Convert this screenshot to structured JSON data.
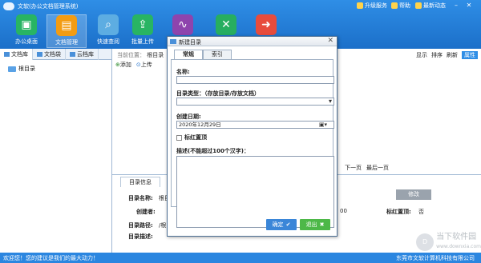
{
  "window": {
    "title": "文软(办公文档管理系统)",
    "top_links": [
      "升级服务",
      "帮助",
      "最新动态"
    ]
  },
  "toolbar": [
    {
      "label": "办公桌面",
      "icon": "desk-icon",
      "color": "#28b463"
    },
    {
      "label": "文档管理",
      "icon": "document-icon",
      "color": "#f39c12",
      "active": true
    },
    {
      "label": "快速查阅",
      "icon": "search-icon",
      "color": "#5dade2"
    },
    {
      "label": "批量上传",
      "icon": "upload-icon",
      "color": "#28b463"
    },
    {
      "label": "",
      "icon": "chart-icon",
      "color": "#8e44ad"
    },
    {
      "label": "",
      "icon": "tools-icon",
      "color": "#27ae60"
    },
    {
      "label": "",
      "icon": "exit-icon",
      "color": "#e74c3c"
    }
  ],
  "left": {
    "tabs": [
      "文档库",
      "文档袋",
      "云档库"
    ],
    "tree_root": "根目录"
  },
  "main": {
    "breadcrumb_label": "当前位置：",
    "breadcrumb_value": "根目录",
    "actions": [
      "添加",
      "上传"
    ],
    "right_actions": [
      "显示",
      "排序",
      "刷新",
      "属性"
    ],
    "pager": [
      "下一页",
      "最后一页"
    ],
    "info_tab": "目录信息",
    "info_labels": [
      "目录名称:",
      "创建者:",
      "目录路径:",
      "目录描述:"
    ],
    "info_values": [
      "根目",
      "",
      "/根目",
      ""
    ],
    "edit_button": "修改",
    "flag_label": "标红置顶:",
    "flag_value": "否",
    "partial_value": "00"
  },
  "dialog": {
    "title": "新建目录",
    "tabs": [
      "常规",
      "索引"
    ],
    "name_label": "名称:",
    "name_value": "",
    "type_label": "目录类型：（存放目录/存放文档）",
    "type_value": "",
    "date_label": "创建日期:",
    "date_value": "2020年12月29日",
    "flag_label": "标红置顶",
    "desc_label": "描述(不能超过100个汉字)：",
    "desc_value": "",
    "ok_button": "确定",
    "exit_button": "退出"
  },
  "status": {
    "left": "欢迎您！您的建议是我们的最大动力！",
    "right": "东莞市文软计算机科技有限公司"
  },
  "watermark": {
    "title": "当下软件园",
    "subtitle": "www.downxia.com"
  },
  "colors": {
    "titlebar": "#2f8ee6",
    "statusbar": "#2b86e0",
    "ok_button": "#3a86d8",
    "exit_button": "#4db848"
  }
}
